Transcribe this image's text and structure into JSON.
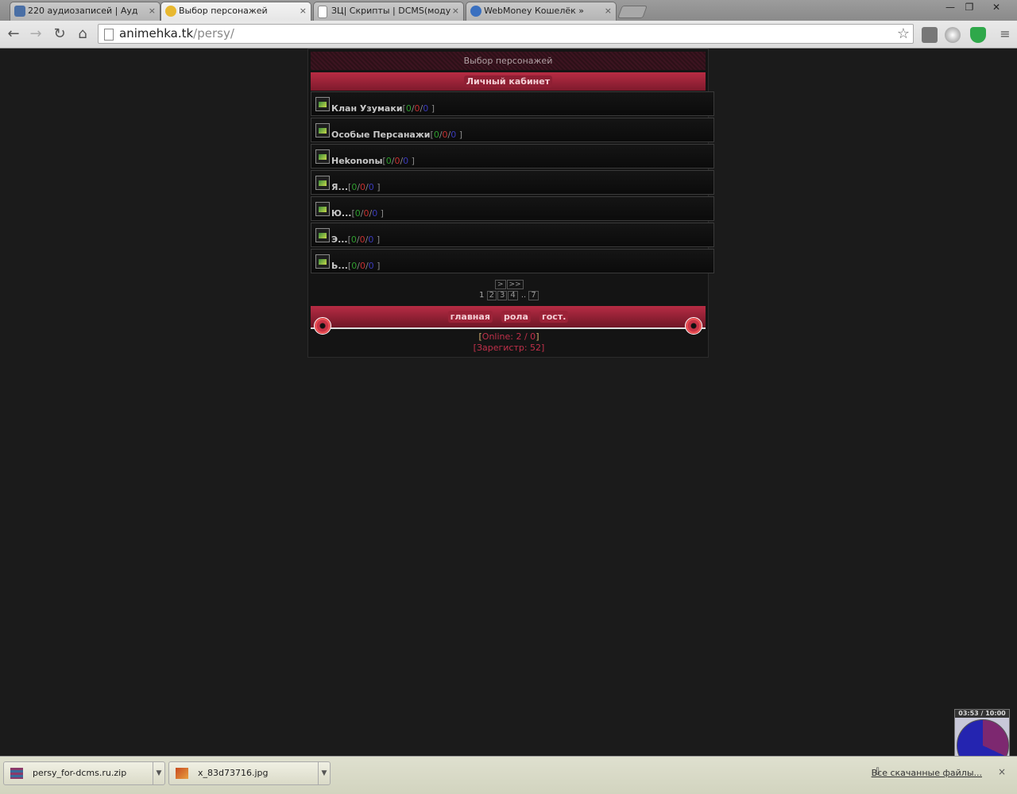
{
  "browser": {
    "tabs": [
      {
        "title": "220 аудиозаписей | Ауд",
        "icon": "vk-icon",
        "color": "#4a6fa5"
      },
      {
        "title": "Выбор персонажей",
        "icon": "smiley-icon",
        "color": "#e8b830"
      },
      {
        "title": "ЗЦ| Скрипты | DCMS(моду",
        "icon": "page-icon",
        "color": "#ffffff"
      },
      {
        "title": "WebMoney Кошелёк »",
        "icon": "webmoney-icon",
        "color": "#3a70c0"
      }
    ],
    "close_glyph": "×",
    "url_host": "animehka.tk",
    "url_path": "/persy/"
  },
  "page": {
    "title": "Выбор персонажей",
    "cabinet_label": "Личный кабинет",
    "groups": [
      {
        "name": "Клан Узумаки",
        "s1": "0",
        "s2": "0",
        "s3": "0"
      },
      {
        "name": "Особые Персанажи",
        "s1": "0",
        "s2": "0",
        "s3": "0"
      },
      {
        "name": "Нekononы",
        "s1": "0",
        "s2": "0",
        "s3": "0"
      },
      {
        "name": "Я...",
        "s1": "0",
        "s2": "0",
        "s3": "0"
      },
      {
        "name": "Ю...",
        "s1": "0",
        "s2": "0",
        "s3": "0"
      },
      {
        "name": "Э...",
        "s1": "0",
        "s2": "0",
        "s3": "0"
      },
      {
        "name": "Ь...",
        "s1": "0",
        "s2": "0",
        "s3": "0"
      }
    ],
    "pager": {
      "next": ">",
      "last": ">>",
      "current": "1",
      "pages": [
        "2",
        "3",
        "4"
      ],
      "ellipsis": "..",
      "last_page": "7"
    },
    "footer": {
      "links": [
        "главная",
        "рола",
        "гост."
      ],
      "online_label": "Online: 2 / 0",
      "registered_label": "Зарегистр: 52"
    }
  },
  "downloads": {
    "items": [
      {
        "name": "persy_for-dcms.ru.zip",
        "icon": "archive-icon"
      },
      {
        "name": "x_83d73716.jpg",
        "icon": "image-file-icon"
      }
    ],
    "show_all": "Все скачанные файлы..."
  },
  "clock": {
    "time": "03:53 / 10:00"
  }
}
